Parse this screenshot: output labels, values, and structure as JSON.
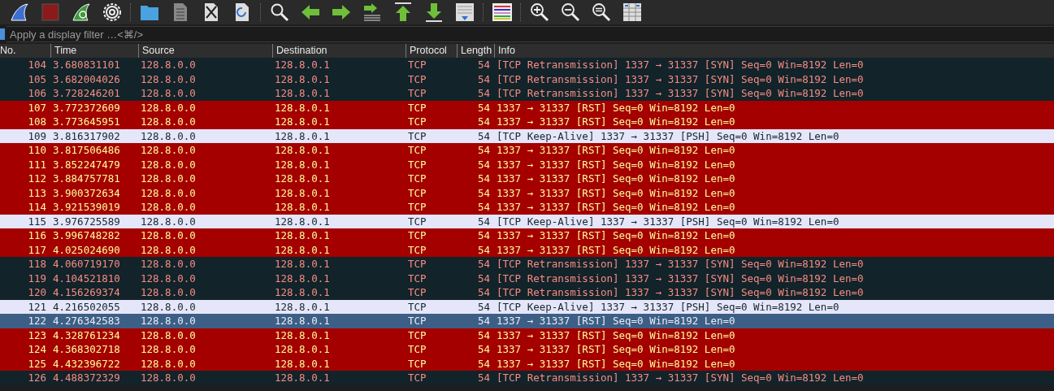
{
  "filter": {
    "placeholder": "Apply a display filter …<⌘/>"
  },
  "table": {
    "columns": [
      "No.",
      "Time",
      "Source",
      "Destination",
      "Protocol",
      "Length",
      "Info"
    ],
    "rows": [
      {
        "kind": "retransmission",
        "selected": false,
        "cells": [
          "104",
          "3.680831101",
          "128.8.0.0",
          "128.8.0.1",
          "TCP",
          "54",
          "[TCP Retransmission] 1337 → 31337 [SYN] Seq=0 Win=8192 Len=0"
        ]
      },
      {
        "kind": "retransmission",
        "selected": false,
        "cells": [
          "105",
          "3.682004026",
          "128.8.0.0",
          "128.8.0.1",
          "TCP",
          "54",
          "[TCP Retransmission] 1337 → 31337 [SYN] Seq=0 Win=8192 Len=0"
        ]
      },
      {
        "kind": "retransmission",
        "selected": false,
        "cells": [
          "106",
          "3.728246201",
          "128.8.0.0",
          "128.8.0.1",
          "TCP",
          "54",
          "[TCP Retransmission] 1337 → 31337 [SYN] Seq=0 Win=8192 Len=0"
        ]
      },
      {
        "kind": "reset",
        "selected": false,
        "cells": [
          "107",
          "3.772372609",
          "128.8.0.0",
          "128.8.0.1",
          "TCP",
          "54",
          "1337 → 31337 [RST] Seq=0 Win=8192 Len=0"
        ]
      },
      {
        "kind": "reset",
        "selected": false,
        "cells": [
          "108",
          "3.773645951",
          "128.8.0.0",
          "128.8.0.1",
          "TCP",
          "54",
          "1337 → 31337 [RST] Seq=0 Win=8192 Len=0"
        ]
      },
      {
        "kind": "keepalive",
        "selected": false,
        "cells": [
          "109",
          "3.816317902",
          "128.8.0.0",
          "128.8.0.1",
          "TCP",
          "54",
          "[TCP Keep-Alive] 1337 → 31337 [PSH] Seq=0 Win=8192 Len=0"
        ]
      },
      {
        "kind": "reset",
        "selected": false,
        "cells": [
          "110",
          "3.817506486",
          "128.8.0.0",
          "128.8.0.1",
          "TCP",
          "54",
          "1337 → 31337 [RST] Seq=0 Win=8192 Len=0"
        ]
      },
      {
        "kind": "reset",
        "selected": false,
        "cells": [
          "111",
          "3.852247479",
          "128.8.0.0",
          "128.8.0.1",
          "TCP",
          "54",
          "1337 → 31337 [RST] Seq=0 Win=8192 Len=0"
        ]
      },
      {
        "kind": "reset",
        "selected": false,
        "cells": [
          "112",
          "3.884757781",
          "128.8.0.0",
          "128.8.0.1",
          "TCP",
          "54",
          "1337 → 31337 [RST] Seq=0 Win=8192 Len=0"
        ]
      },
      {
        "kind": "reset",
        "selected": false,
        "cells": [
          "113",
          "3.900372634",
          "128.8.0.0",
          "128.8.0.1",
          "TCP",
          "54",
          "1337 → 31337 [RST] Seq=0 Win=8192 Len=0"
        ]
      },
      {
        "kind": "reset",
        "selected": false,
        "cells": [
          "114",
          "3.921539019",
          "128.8.0.0",
          "128.8.0.1",
          "TCP",
          "54",
          "1337 → 31337 [RST] Seq=0 Win=8192 Len=0"
        ]
      },
      {
        "kind": "keepalive",
        "selected": false,
        "cells": [
          "115",
          "3.976725589",
          "128.8.0.0",
          "128.8.0.1",
          "TCP",
          "54",
          "[TCP Keep-Alive] 1337 → 31337 [PSH] Seq=0 Win=8192 Len=0"
        ]
      },
      {
        "kind": "reset",
        "selected": false,
        "cells": [
          "116",
          "3.996748282",
          "128.8.0.0",
          "128.8.0.1",
          "TCP",
          "54",
          "1337 → 31337 [RST] Seq=0 Win=8192 Len=0"
        ]
      },
      {
        "kind": "reset",
        "selected": false,
        "cells": [
          "117",
          "4.025024690",
          "128.8.0.0",
          "128.8.0.1",
          "TCP",
          "54",
          "1337 → 31337 [RST] Seq=0 Win=8192 Len=0"
        ]
      },
      {
        "kind": "retransmission",
        "selected": false,
        "cells": [
          "118",
          "4.060719170",
          "128.8.0.0",
          "128.8.0.1",
          "TCP",
          "54",
          "[TCP Retransmission] 1337 → 31337 [SYN] Seq=0 Win=8192 Len=0"
        ]
      },
      {
        "kind": "retransmission",
        "selected": false,
        "cells": [
          "119",
          "4.104521810",
          "128.8.0.0",
          "128.8.0.1",
          "TCP",
          "54",
          "[TCP Retransmission] 1337 → 31337 [SYN] Seq=0 Win=8192 Len=0"
        ]
      },
      {
        "kind": "retransmission",
        "selected": false,
        "cells": [
          "120",
          "4.156269374",
          "128.8.0.0",
          "128.8.0.1",
          "TCP",
          "54",
          "[TCP Retransmission] 1337 → 31337 [SYN] Seq=0 Win=8192 Len=0"
        ]
      },
      {
        "kind": "keepalive",
        "selected": false,
        "cells": [
          "121",
          "4.216502055",
          "128.8.0.0",
          "128.8.0.1",
          "TCP",
          "54",
          "[TCP Keep-Alive] 1337 → 31337 [PSH] Seq=0 Win=8192 Len=0"
        ]
      },
      {
        "kind": "reset",
        "selected": true,
        "cells": [
          "122",
          "4.276342583",
          "128.8.0.0",
          "128.8.0.1",
          "TCP",
          "54",
          "1337 → 31337 [RST] Seq=0 Win=8192 Len=0"
        ]
      },
      {
        "kind": "reset",
        "selected": false,
        "cells": [
          "123",
          "4.328761234",
          "128.8.0.0",
          "128.8.0.1",
          "TCP",
          "54",
          "1337 → 31337 [RST] Seq=0 Win=8192 Len=0"
        ]
      },
      {
        "kind": "reset",
        "selected": false,
        "cells": [
          "124",
          "4.368302718",
          "128.8.0.0",
          "128.8.0.1",
          "TCP",
          "54",
          "1337 → 31337 [RST] Seq=0 Win=8192 Len=0"
        ]
      },
      {
        "kind": "reset",
        "selected": false,
        "cells": [
          "125",
          "4.432396722",
          "128.8.0.0",
          "128.8.0.1",
          "TCP",
          "54",
          "1337 → 31337 [RST] Seq=0 Win=8192 Len=0"
        ]
      },
      {
        "kind": "retransmission",
        "selected": false,
        "cells": [
          "126",
          "4.488372329",
          "128.8.0.0",
          "128.8.0.1",
          "TCP",
          "54",
          "[TCP Retransmission] 1337 → 31337 [SYN] Seq=0 Win=8192 Len=0"
        ]
      }
    ]
  }
}
